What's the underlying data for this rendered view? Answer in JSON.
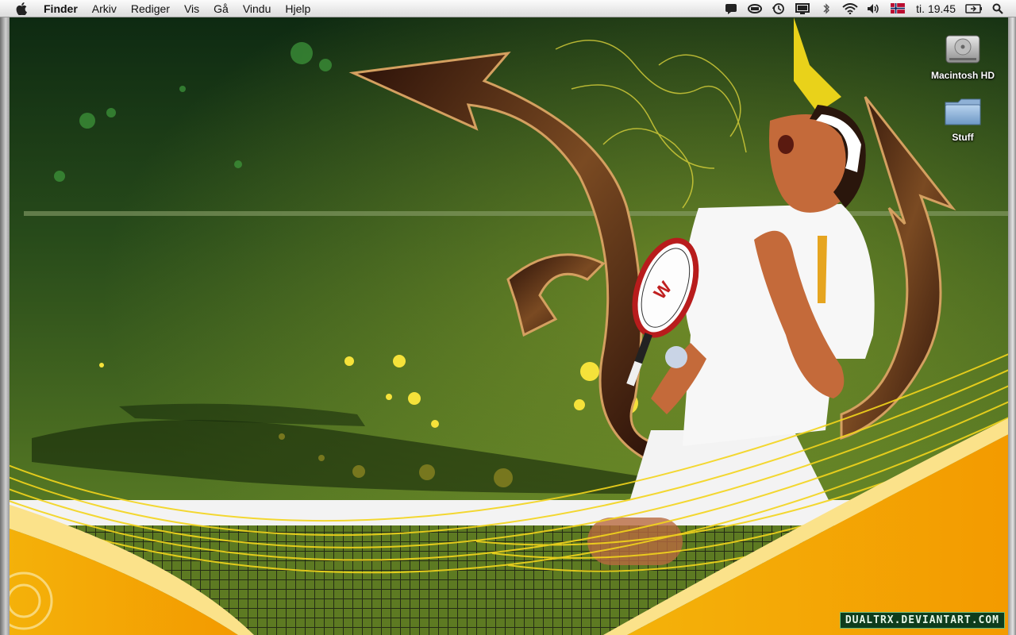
{
  "menubar": {
    "apple_icon": "apple-icon",
    "items": [
      "Finder",
      "Arkiv",
      "Rediger",
      "Vis",
      "Gå",
      "Vindu",
      "Hjelp"
    ],
    "status_icons": [
      "speech-icon",
      "keychain-icon",
      "time-machine-icon",
      "display-icon",
      "bluetooth-icon",
      "wifi-icon",
      "volume-icon",
      "norwegian-flag-icon"
    ],
    "clock": "ti. 19.45",
    "battery_icon": "battery-icon",
    "spotlight_icon": "spotlight-search-icon"
  },
  "desktop": {
    "icons": [
      {
        "label": "Macintosh HD",
        "icon": "hard-drive-icon"
      },
      {
        "label": "Stuff",
        "icon": "folder-icon"
      }
    ],
    "watermark": "DUALTRX.DEVIANTART.COM"
  },
  "colors": {
    "grass_dark": "#2d4a16",
    "grass_light": "#7a9a2a",
    "accent_orange": "#f2a400",
    "accent_yellow": "#f7e11a",
    "brown": "#4a2410",
    "menubar": "#ededed"
  }
}
